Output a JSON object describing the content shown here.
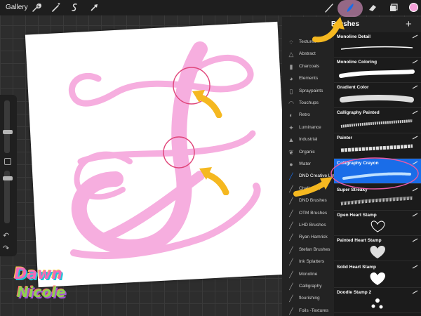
{
  "toolbar": {
    "gallery_label": "Gallery",
    "icons": [
      "wrench-icon",
      "magic-wand-icon",
      "selection-icon",
      "transform-arrow-icon",
      "brush-icon",
      "smudge-icon",
      "eraser-icon",
      "layers-icon"
    ],
    "active_tool": "brush-icon",
    "current_color": "#f4a0d8"
  },
  "panel": {
    "title": "Brushes",
    "add_label": "+",
    "categories": [
      {
        "label": "Textures",
        "icon": "textures-icon"
      },
      {
        "label": "Abstract",
        "icon": "abstract-icon"
      },
      {
        "label": "Charcoals",
        "icon": "charcoals-icon"
      },
      {
        "label": "Elements",
        "icon": "elements-icon"
      },
      {
        "label": "Spraypaints",
        "icon": "spraypaints-icon"
      },
      {
        "label": "Touchups",
        "icon": "touchups-icon"
      },
      {
        "label": "Retro",
        "icon": "retro-icon"
      },
      {
        "label": "Luminance",
        "icon": "luminance-icon"
      },
      {
        "label": "Industrial",
        "icon": "industrial-icon"
      },
      {
        "label": "Organic",
        "icon": "organic-icon"
      },
      {
        "label": "Water",
        "icon": "water-icon"
      },
      {
        "label": "DND Creative Letteri...",
        "icon": "brush-set-icon",
        "active": true
      },
      {
        "label": "Chalk Text",
        "icon": "brush-set-icon"
      },
      {
        "label": "DND Brushes",
        "icon": "brush-set-icon"
      },
      {
        "label": "OTM Brushes",
        "icon": "brush-set-icon"
      },
      {
        "label": "LHD Brushes",
        "icon": "brush-set-icon"
      },
      {
        "label": "Ryan Hamrick",
        "icon": "brush-set-icon"
      },
      {
        "label": "Stefan Brushes",
        "icon": "brush-set-icon"
      },
      {
        "label": "Ink Splatters",
        "icon": "brush-set-icon"
      },
      {
        "label": "Monoline",
        "icon": "brush-set-icon"
      },
      {
        "label": "Calligraphy",
        "icon": "brush-set-icon"
      },
      {
        "label": "flourishing",
        "icon": "brush-set-icon"
      },
      {
        "label": "Foils -Textures",
        "icon": "brush-set-icon"
      }
    ],
    "brushes": [
      {
        "label": "Monoline Detail",
        "stroke": "thin"
      },
      {
        "label": "Monoline Coloring",
        "stroke": "thick"
      },
      {
        "label": "Gradient Color",
        "stroke": "glow"
      },
      {
        "label": "Calligraphy Painted",
        "stroke": "painted"
      },
      {
        "label": "Painter",
        "stroke": "painter"
      },
      {
        "label": "Calligraphy Crayon",
        "stroke": "crayon",
        "selected": true
      },
      {
        "label": "Super Streaky",
        "stroke": "streaky"
      },
      {
        "label": "Open Heart Stamp",
        "stroke": "open-heart"
      },
      {
        "label": "Painted Heart Stamp",
        "stroke": "painted-heart"
      },
      {
        "label": "Solid Heart Stamp",
        "stroke": "solid-heart"
      },
      {
        "label": "Doodle Stamp 2",
        "stroke": "doodle"
      }
    ]
  },
  "logo": {
    "line1": "Dawn",
    "line2": "Nicole"
  },
  "colors": {
    "accent_pink": "#f4a0d8",
    "annotation_arrow": "#f5b820",
    "selected_blue": "#1a6de8"
  }
}
